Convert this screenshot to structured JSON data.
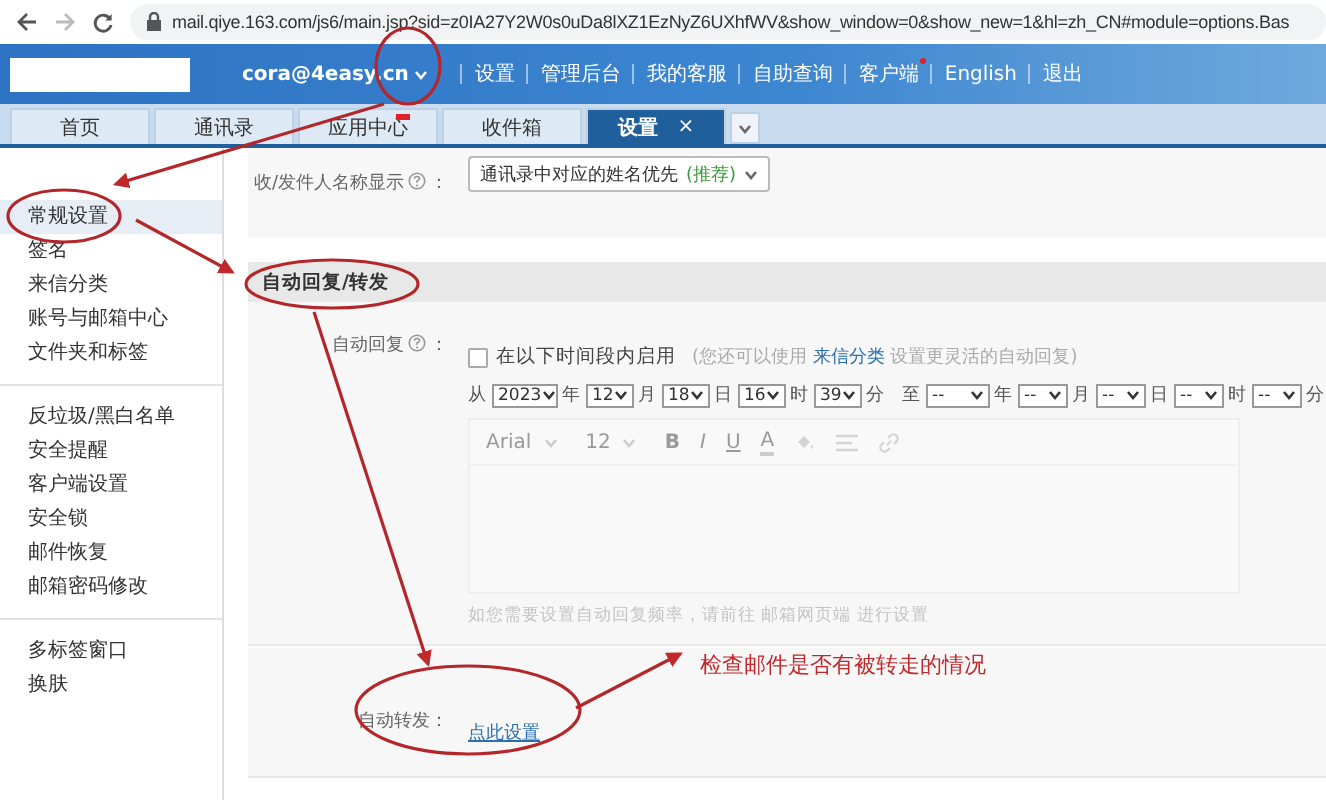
{
  "browser": {
    "url": "mail.qiye.163.com/js6/main.jsp?sid=z0IA27Y2W0s0uDa8lXZ1EzNyZ6UXhfWV&show_window=0&show_new=1&hl=zh_CN#module=options.Bas"
  },
  "header": {
    "account": "cora@4easy.cn",
    "links": [
      {
        "label": "设置",
        "dot": false
      },
      {
        "label": "管理后台",
        "dot": false
      },
      {
        "label": "我的客服",
        "dot": false
      },
      {
        "label": "自助查询",
        "dot": false
      },
      {
        "label": "客户端",
        "dot": true
      },
      {
        "label": "English",
        "dot": false
      },
      {
        "label": "退出",
        "dot": false
      }
    ]
  },
  "tabs": [
    {
      "label": "首页",
      "selected": false,
      "badge": false
    },
    {
      "label": "通讯录",
      "selected": false,
      "badge": false
    },
    {
      "label": "应用中心",
      "selected": false,
      "badge": true
    },
    {
      "label": "收件箱",
      "selected": false,
      "badge": false
    },
    {
      "label": "设置",
      "selected": true,
      "badge": false,
      "close": "×"
    }
  ],
  "sidebar": {
    "groups": [
      {
        "items": [
          {
            "label": "常规设置",
            "selected": true
          },
          {
            "label": "签名",
            "selected": false
          },
          {
            "label": "来信分类",
            "selected": false
          },
          {
            "label": "账号与邮箱中心",
            "selected": false
          },
          {
            "label": "文件夹和标签",
            "selected": false
          }
        ]
      },
      {
        "items": [
          {
            "label": "反垃圾/黑白名单",
            "selected": false
          },
          {
            "label": "安全提醒",
            "selected": false
          },
          {
            "label": "客户端设置",
            "selected": false
          },
          {
            "label": "安全锁",
            "selected": false
          },
          {
            "label": "邮件恢复",
            "selected": false
          },
          {
            "label": "邮箱密码修改",
            "selected": false
          }
        ]
      },
      {
        "items": [
          {
            "label": "多标签窗口",
            "selected": false
          },
          {
            "label": "换肤",
            "selected": false
          }
        ]
      }
    ]
  },
  "options": {
    "name_display": {
      "label": "收/发件人名称显示",
      "colon": "：",
      "value": "通讯录中对应的姓名优先",
      "note": "(推荐)"
    },
    "section_title": "自动回复/转发",
    "auto_reply": {
      "label": "自动回复",
      "colon": "：",
      "checkbox": {
        "label": "在以下时间段内启用",
        "checked": false
      },
      "hint_before": "(您还可以使用",
      "hint_link": "来信分类",
      "hint_after": "设置更灵活的自动回复)",
      "from": "从",
      "to": "至",
      "start": [
        {
          "value": "2023",
          "unit": "年"
        },
        {
          "value": "12",
          "unit": "月"
        },
        {
          "value": "18",
          "unit": "日"
        },
        {
          "value": "16",
          "unit": "时"
        },
        {
          "value": "39",
          "unit": "分"
        }
      ],
      "end": [
        {
          "value": "--",
          "unit": "年"
        },
        {
          "value": "--",
          "unit": "月"
        },
        {
          "value": "--",
          "unit": "日"
        },
        {
          "value": "--",
          "unit": "时"
        },
        {
          "value": "--",
          "unit": "分"
        }
      ],
      "toolbar": [
        {
          "kind": "dropdown",
          "label": "Arial"
        },
        {
          "kind": "dropdown",
          "label": "12"
        },
        {
          "kind": "bold",
          "label": "B"
        },
        {
          "kind": "italic",
          "label": "I"
        },
        {
          "kind": "underline",
          "label": "U"
        },
        {
          "kind": "color",
          "label": "A"
        },
        {
          "kind": "fill"
        },
        {
          "kind": "align"
        },
        {
          "kind": "link"
        }
      ],
      "footnote": "如您需要设置自动回复频率，请前往 邮箱网页端 进行设置"
    },
    "auto_forward": {
      "label": "自动转发",
      "colon": "：",
      "link": "点此设置"
    }
  },
  "annotation": {
    "note": "检查邮件是否有被转走的情况"
  }
}
